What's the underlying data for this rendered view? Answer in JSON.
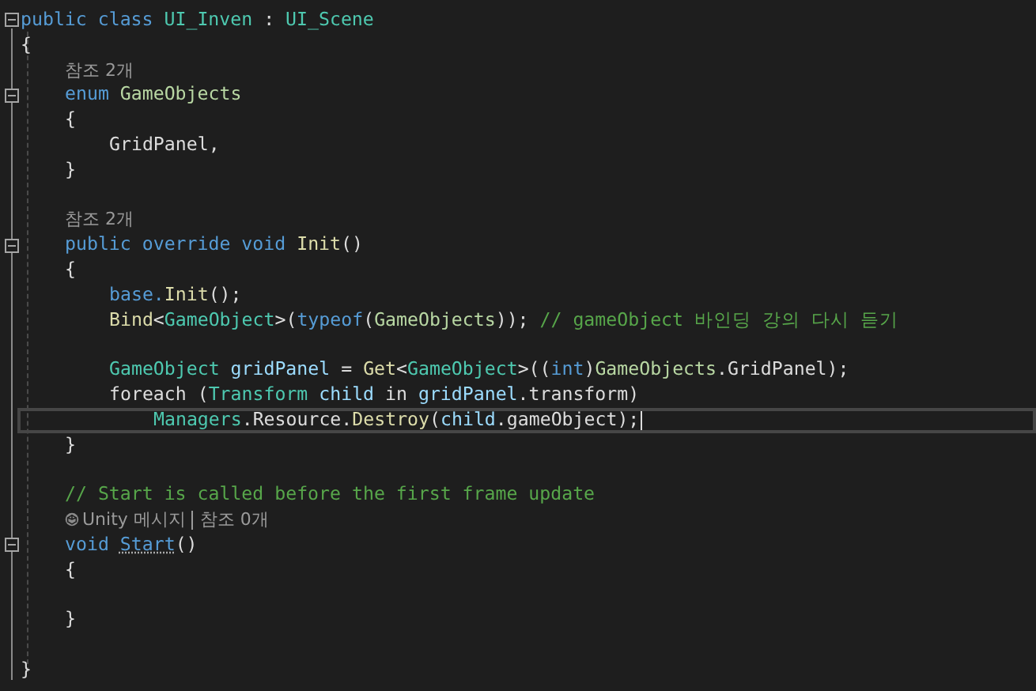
{
  "editor": {
    "lines": [
      {
        "kind": "code",
        "selected": false,
        "expanded": true,
        "tokens": [
          {
            "text": "public class ",
            "kind": "keyword"
          },
          {
            "text": "UI_Inven",
            "kind": "type"
          },
          {
            "text": " : ",
            "kind": "plain"
          },
          {
            "text": "UI_Scene",
            "kind": "type"
          }
        ]
      },
      {
        "kind": "code",
        "selected": false,
        "tokens": [
          {
            "text": "{",
            "kind": "plain"
          }
        ],
        "children": [
          {
            "kind": "lens",
            "selected": false,
            "items": [
              "참조 2개"
            ]
          },
          {
            "kind": "code",
            "selected": false,
            "expanded": true,
            "tokens": [
              {
                "text": "enum ",
                "kind": "keyword"
              },
              {
                "text": "GameObjects",
                "kind": "enum"
              }
            ]
          },
          {
            "kind": "code",
            "selected": false,
            "tokens": [
              {
                "text": "{",
                "kind": "plain"
              }
            ],
            "children": [
              {
                "kind": "code",
                "selected": false,
                "tokens": [
                  {
                    "text": "GridPanel,",
                    "kind": "plain"
                  }
                ]
              }
            ]
          },
          {
            "kind": "code",
            "selected": false,
            "tokens": [
              {
                "text": "}",
                "kind": "plain"
              }
            ]
          },
          {
            "kind": "blank",
            "selected": false
          },
          {
            "kind": "lens",
            "selected": false,
            "items": [
              "참조 2개"
            ]
          },
          {
            "kind": "code",
            "selected": false,
            "expanded": true,
            "tokens": [
              {
                "text": "public override void ",
                "kind": "keyword"
              },
              {
                "text": "Init",
                "kind": "method"
              },
              {
                "text": "()",
                "kind": "plain"
              }
            ]
          },
          {
            "kind": "code",
            "selected": false,
            "tokens": [
              {
                "text": "{",
                "kind": "plain"
              }
            ],
            "children": [
              {
                "kind": "code",
                "selected": false,
                "tokens": [
                  {
                    "text": "base.",
                    "kind": "keyword"
                  },
                  {
                    "text": "Init",
                    "kind": "method"
                  },
                  {
                    "text": "();",
                    "kind": "plain"
                  }
                ]
              },
              {
                "kind": "code",
                "selected": false,
                "tokens": [
                  {
                    "text": "Bind",
                    "kind": "method"
                  },
                  {
                    "text": "<",
                    "kind": "plain"
                  },
                  {
                    "text": "GameObject",
                    "kind": "type"
                  },
                  {
                    "text": ">(",
                    "kind": "plain"
                  },
                  {
                    "text": "typeof",
                    "kind": "keyword"
                  },
                  {
                    "text": "(",
                    "kind": "plain"
                  },
                  {
                    "text": "GameObjects",
                    "kind": "enum"
                  },
                  {
                    "text": ")); ",
                    "kind": "plain"
                  },
                  {
                    "text": "// gameObject 바인딩 강의 다시 듣기",
                    "kind": "comment"
                  }
                ]
              },
              {
                "kind": "blank",
                "selected": false
              },
              {
                "kind": "code",
                "selected": false,
                "tokens": [
                  {
                    "text": "GameObject ",
                    "kind": "type"
                  },
                  {
                    "text": "gridPanel",
                    "kind": "variable"
                  },
                  {
                    "text": " = ",
                    "kind": "plain"
                  },
                  {
                    "text": "Get",
                    "kind": "method"
                  },
                  {
                    "text": "<",
                    "kind": "plain"
                  },
                  {
                    "text": "GameObject",
                    "kind": "type"
                  },
                  {
                    "text": ">((",
                    "kind": "plain"
                  },
                  {
                    "text": "int",
                    "kind": "keyword"
                  },
                  {
                    "text": ")",
                    "kind": "plain"
                  },
                  {
                    "text": "GameObjects",
                    "kind": "enum"
                  },
                  {
                    "text": ".GridPanel);",
                    "kind": "plain"
                  }
                ]
              },
              {
                "kind": "code",
                "selected": false,
                "tokens": [
                  {
                    "text": "foreach (",
                    "kind": "plain"
                  },
                  {
                    "text": "Transform ",
                    "kind": "type"
                  },
                  {
                    "text": "child",
                    "kind": "variable"
                  },
                  {
                    "text": " in ",
                    "kind": "plain"
                  },
                  {
                    "text": "gridPanel",
                    "kind": "variable"
                  },
                  {
                    "text": ".transform)",
                    "kind": "plain"
                  }
                ],
                "children": [
                  {
                    "kind": "code",
                    "selected": true,
                    "tokens": [
                      {
                        "text": "Managers",
                        "kind": "type"
                      },
                      {
                        "text": ".Resource.",
                        "kind": "plain"
                      },
                      {
                        "text": "Destroy",
                        "kind": "method"
                      },
                      {
                        "text": "(",
                        "kind": "plain"
                      },
                      {
                        "text": "child",
                        "kind": "variable"
                      },
                      {
                        "text": ".gameObject);",
                        "kind": "plain"
                      }
                    ]
                  }
                ]
              }
            ]
          },
          {
            "kind": "code",
            "selected": false,
            "tokens": [
              {
                "text": "}",
                "kind": "plain"
              }
            ]
          },
          {
            "kind": "blank",
            "selected": false
          },
          {
            "kind": "code",
            "selected": false,
            "tokens": [
              {
                "text": "// Start is called before the first frame update",
                "kind": "comment"
              }
            ]
          },
          {
            "kind": "unity-lens",
            "selected": false,
            "items": [
              "Unity 메시지",
              "참조 0개"
            ]
          },
          {
            "kind": "code",
            "selected": false,
            "expanded": true,
            "tokens": [
              {
                "text": "void ",
                "kind": "keyword"
              },
              {
                "text": "Start",
                "kind": "suggested"
              },
              {
                "text": "()",
                "kind": "plain"
              }
            ]
          },
          {
            "kind": "code",
            "selected": false,
            "tokens": [
              {
                "text": "{",
                "kind": "plain"
              }
            ],
            "children": [
              {
                "kind": "blank",
                "selected": false
              }
            ]
          },
          {
            "kind": "code",
            "selected": false,
            "tokens": [
              {
                "text": "}",
                "kind": "plain"
              }
            ]
          },
          {
            "kind": "blank",
            "selected": false
          }
        ]
      },
      {
        "kind": "code",
        "selected": false,
        "tokens": [
          {
            "text": "}",
            "kind": "plain"
          }
        ]
      }
    ]
  }
}
